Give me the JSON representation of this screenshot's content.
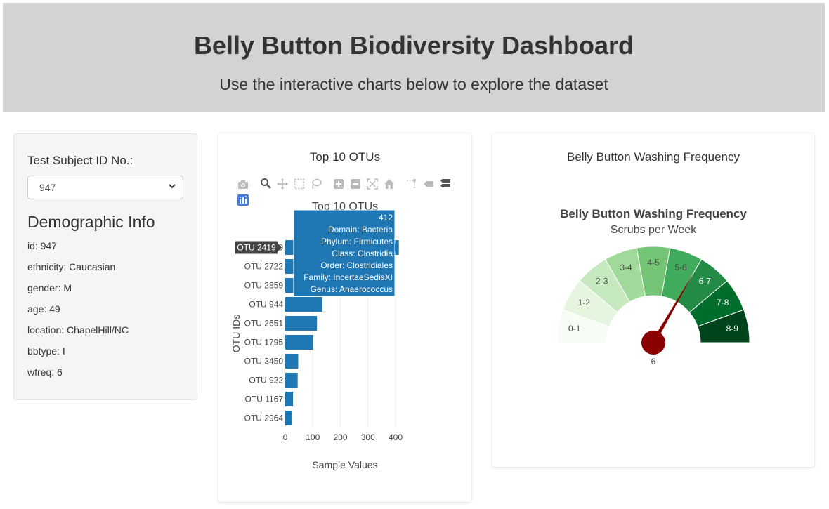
{
  "header": {
    "title": "Belly Button Biodiversity Dashboard",
    "subtitle": "Use the interactive charts below to explore the dataset"
  },
  "sidebar": {
    "select_label": "Test Subject ID No.:",
    "selected_id": "947",
    "demo_title": "Demographic Info",
    "demo_items": [
      "id: 947",
      "ethnicity: Caucasian",
      "gender: M",
      "age: 49",
      "location: ChapelHill/NC",
      "bbtype: I",
      "wfreq: 6"
    ]
  },
  "bar_card": {
    "card_title": "Top 10 OTUs",
    "modebar_icons": [
      "camera-icon",
      "zoom-icon",
      "pan-icon",
      "box-select-icon",
      "lasso-icon",
      "zoom-in-icon",
      "zoom-out-icon",
      "autoscale-icon",
      "home-icon",
      "spike-lines-icon",
      "hover-closest-icon",
      "hover-compare-icon",
      "plotly-logo-icon"
    ]
  },
  "gauge_card": {
    "card_title": "Belly Button Washing Frequency"
  },
  "colors": {
    "bar": "#1f77b4",
    "tooltip_bg": "#1f77b4",
    "needle": "#8b0000",
    "gauge_steps": [
      "#f7fcf5",
      "#e5f5e0",
      "#c7e9c0",
      "#a1d99b",
      "#74c476",
      "#41ab5d",
      "#238b45",
      "#006d2c",
      "#00441b"
    ]
  },
  "chart_data": [
    {
      "type": "bar",
      "orientation": "horizontal",
      "title": "Top 10 OTUs",
      "xlabel": "Sample Values",
      "ylabel": "OTU IDs",
      "xlim": [
        0,
        400
      ],
      "xticks": [
        "0",
        "100",
        "200",
        "300",
        "400"
      ],
      "categories": [
        "OTU 2419",
        "OTU 2722",
        "OTU 2859",
        "OTU 944",
        "OTU 2651",
        "OTU 1795",
        "OTU 3450",
        "OTU 922",
        "OTU 1167",
        "OTU 2964"
      ],
      "values": [
        412,
        146,
        104,
        134,
        115,
        101,
        47,
        45,
        28,
        25
      ],
      "grid": true,
      "hover": {
        "category": "OTU 2419",
        "lines": [
          "412",
          "Domain: Bacteria",
          "Phylum: Firmicutes",
          "Class: Clostridia",
          "Order: Clostridiales",
          "Family: IncertaeSedisXI",
          "Genus: Anaerococcus"
        ]
      }
    },
    {
      "type": "gauge",
      "title": "Belly Button Washing Frequency",
      "subtitle": "Scrubs per Week",
      "range": [
        0,
        9
      ],
      "step_labels": [
        "0-1",
        "1-2",
        "2-3",
        "3-4",
        "4-5",
        "5-6",
        "6-7",
        "7-8",
        "8-9"
      ],
      "value": 6,
      "value_label": "6"
    }
  ]
}
